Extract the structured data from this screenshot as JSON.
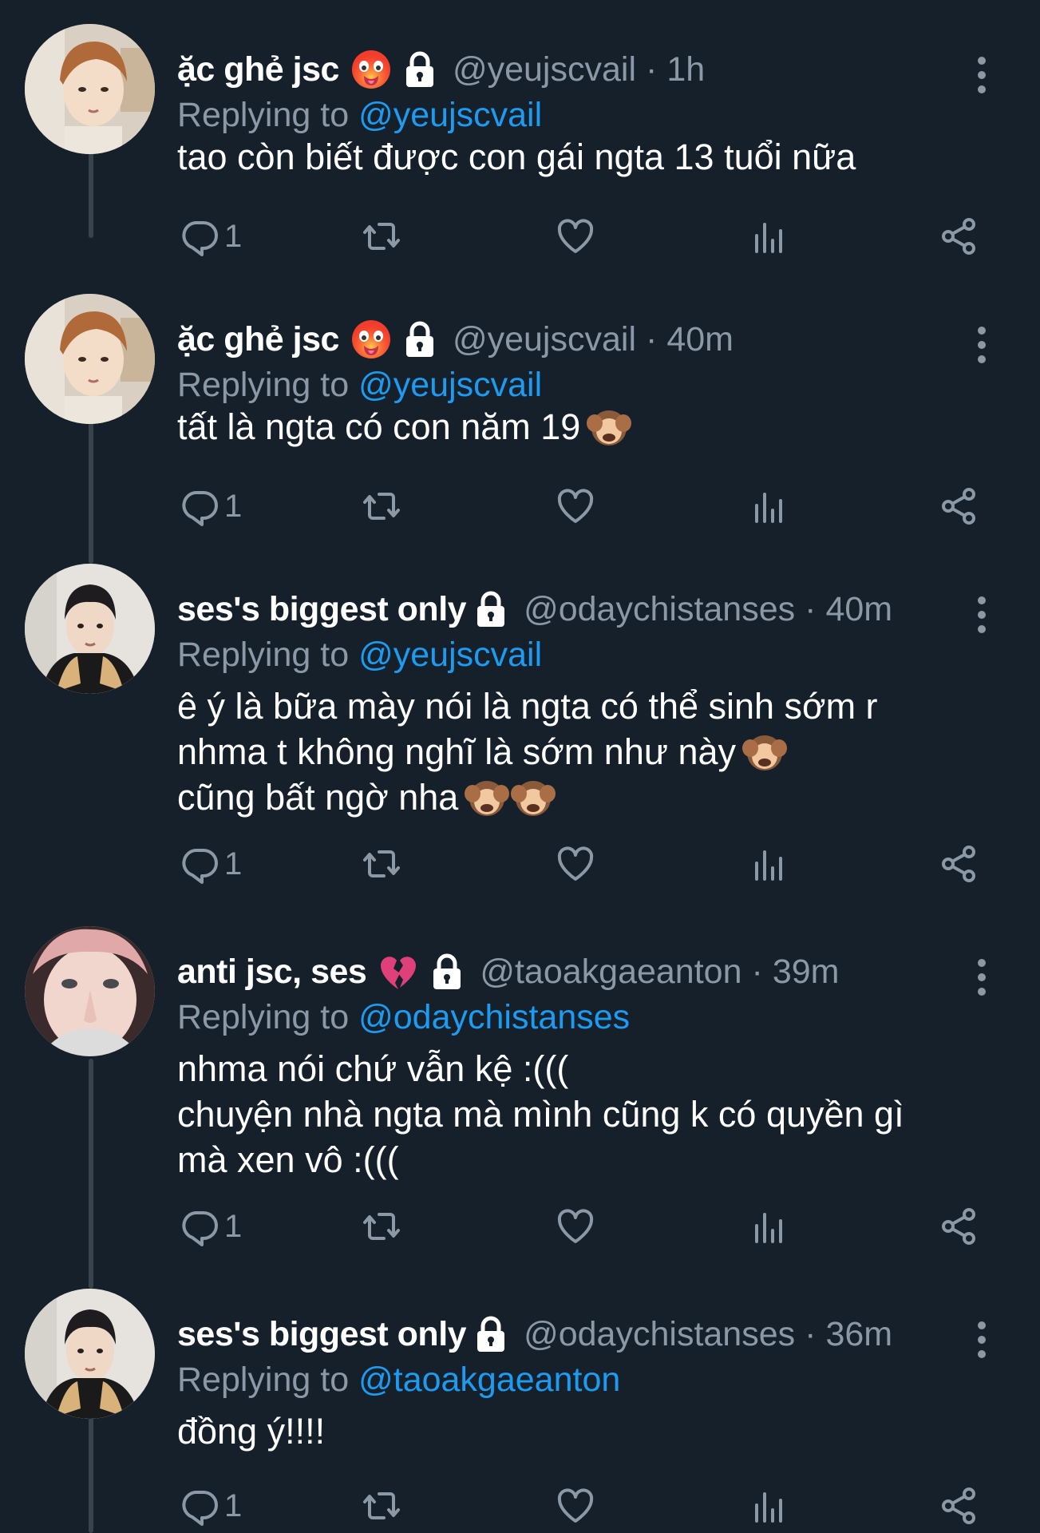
{
  "tweets": [
    {
      "name": "ặc ghẻ jsc",
      "has_hot_emoji": true,
      "has_broken_heart": false,
      "handle": "@yeujscvail",
      "separator": "·",
      "time": "1h",
      "replying_prefix": "Replying to",
      "replying_to": "@yeujscvail",
      "lines": [
        "tao còn biết được con gái ngta 13 tuổi nữa"
      ],
      "reply_count": "1",
      "avatar": "orange-hair"
    },
    {
      "name": "ặc ghẻ jsc",
      "has_hot_emoji": true,
      "has_broken_heart": false,
      "handle": "@yeujscvail",
      "separator": "·",
      "time": "40m",
      "replying_prefix": "Replying to",
      "replying_to": "@yeujscvail",
      "lines": [
        "tất là ngta có con năm 19"
      ],
      "reply_count": "1",
      "avatar": "orange-hair"
    },
    {
      "name": "ses's biggest only",
      "has_hot_emoji": false,
      "has_broken_heart": false,
      "handle": "@odaychistanses",
      "separator": "·",
      "time": "40m",
      "replying_prefix": "Replying to",
      "replying_to": "@yeujscvail",
      "lines": [
        "ê ý là bữa mày nói là ngta có thể sinh sớm r",
        "nhma t không nghĩ là sớm như này",
        "cũng bất ngờ nha"
      ],
      "reply_count": "1",
      "avatar": "dark-hair"
    },
    {
      "name": "anti jsc, ses",
      "has_hot_emoji": false,
      "has_broken_heart": true,
      "handle": "@taoakgaeanton",
      "separator": "·",
      "time": "39m",
      "replying_prefix": "Replying to",
      "replying_to": "@odaychistanses",
      "lines": [
        "nhma nói chứ vẫn kệ :(((",
        "chuyện nhà ngta mà mình cũng k có quyền gì",
        "mà xen vô :((("
      ],
      "reply_count": "1",
      "avatar": "pink-hair"
    },
    {
      "name": "ses's biggest only",
      "has_hot_emoji": false,
      "has_broken_heart": false,
      "handle": "@odaychistanses",
      "separator": "·",
      "time": "36m",
      "replying_prefix": "Replying to",
      "replying_to": "@taoakgaeanton",
      "lines": [
        "đồng ý!!!!"
      ],
      "reply_count": "1",
      "avatar": "dark-hair"
    }
  ],
  "icons": {
    "reply": "reply-icon",
    "retweet": "retweet-icon",
    "like": "like-icon",
    "views": "views-icon",
    "share": "share-icon",
    "more": "more-icon",
    "lock": "lock-icon",
    "monkey": "see-no-evil-monkey-icon"
  },
  "colors": {
    "background": "#15202b",
    "mention": "#1d9bf0",
    "muted": "#8b98a5"
  }
}
